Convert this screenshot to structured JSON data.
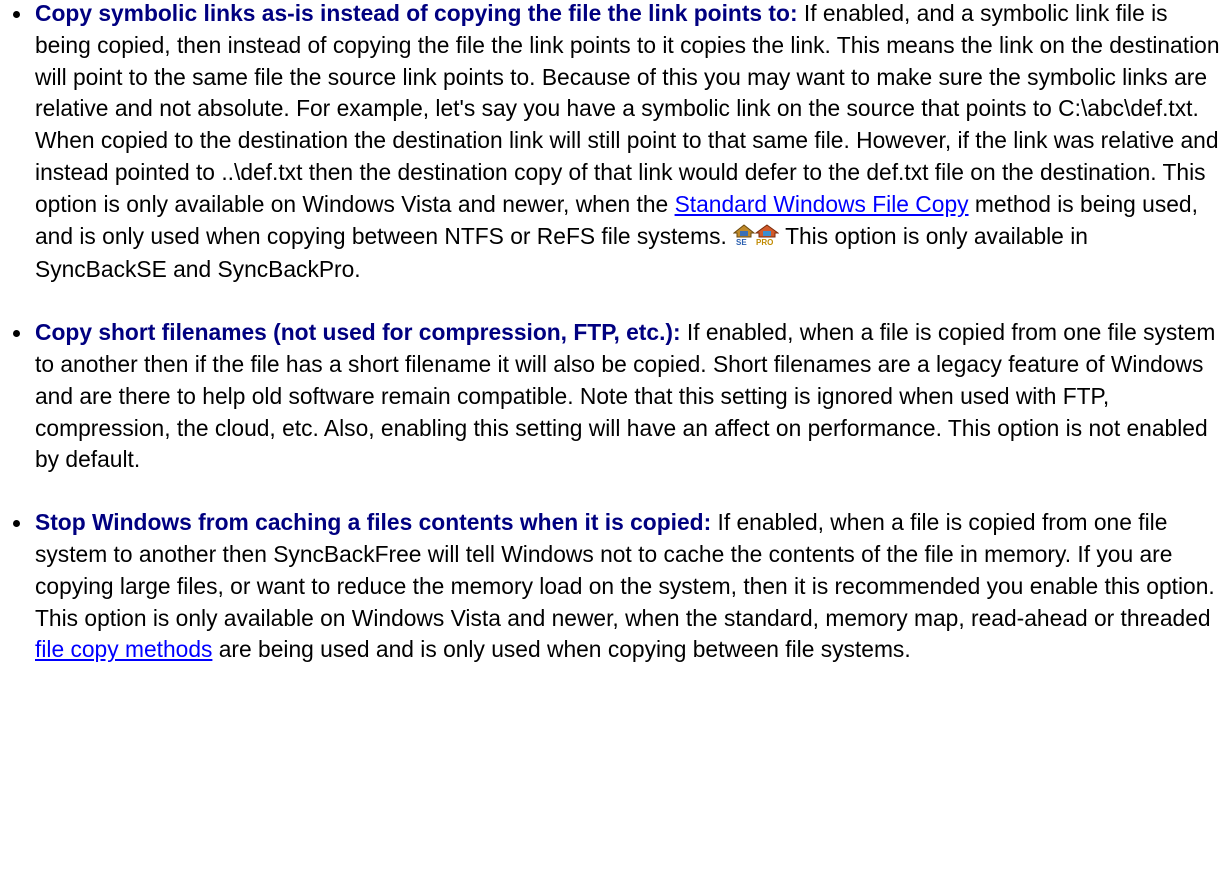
{
  "options": [
    {
      "title": "Copy symbolic links as-is instead of copying the file the link points to:",
      "text_before_link": " If enabled, and a symbolic link file is being copied, then instead of copying the file the link points to it copies the link. This means the link on the destination  will point to the same file the source link points to. Because of this you may want to make sure the symbolic links are relative and not absolute. For example, let's say you have a symbolic link on the source that points to C:\\abc\\def.txt. When copied to the destination the destination link will still point to that same file. However, if the link was relative and instead pointed to ..\\def.txt then the destination copy of that link would defer to the def.txt file on the destination. This option is only available on Windows Vista and newer, when the ",
      "link": "Standard Windows File Copy",
      "text_after_link": " method is being used, and is only used when copying between NTFS or ReFS file systems. ",
      "edition_note": " This option is only available in SyncBackSE and SyncBackPro.",
      "edition_icons": [
        "syncbackse-icon",
        "syncbackpro-icon"
      ]
    },
    {
      "title": "Copy short filenames (not used for compression, FTP, etc.):",
      "text": " If enabled, when a file is copied from one file system to another then if the file has a short filename it will also be copied. Short filenames are a legacy feature of Windows and are there to help old software remain compatible. Note that this setting is ignored when used with FTP, compression, the cloud, etc. Also, enabling this setting will have an affect on performance. This option is not enabled by default."
    },
    {
      "title": "Stop Windows from caching a files contents when it is copied:",
      "text_before_link": " If enabled, when a file is copied from one file system to another then SyncBackFree will tell Windows not to cache the contents of the file in memory. If you are copying large files, or want to reduce the memory load on the system, then it is recommended you enable this option. This option is only available on Windows Vista and newer, when the standard, memory map, read-ahead or threaded ",
      "link": "file copy methods",
      "text_after_link": " are being used and is only used when copying between file systems."
    }
  ],
  "colors": {
    "title": "#000080",
    "link": "#0000ff",
    "text": "#000000"
  }
}
